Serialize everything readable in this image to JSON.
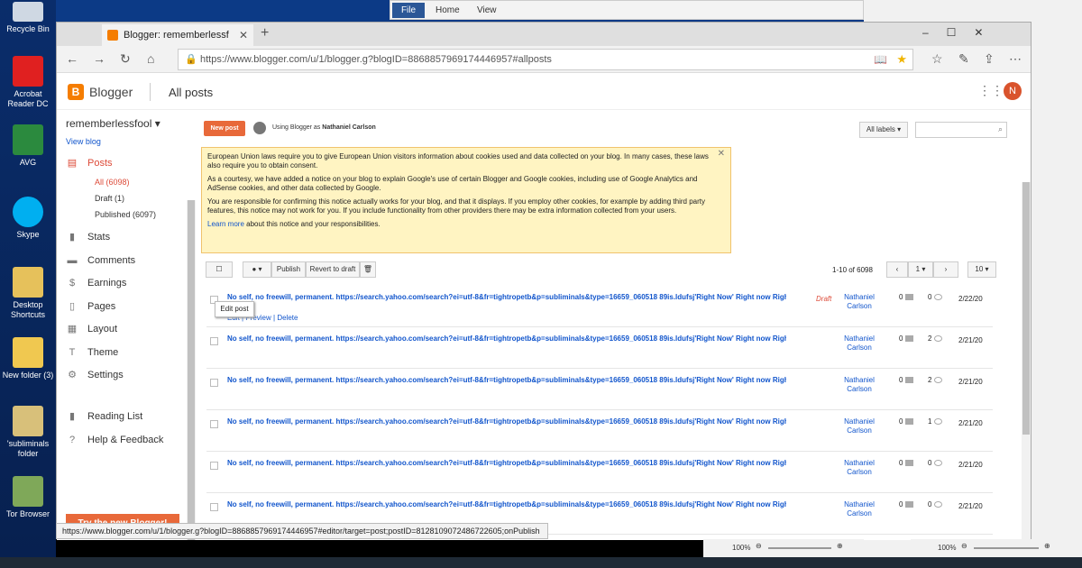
{
  "desktop": {
    "icons": [
      "Recycle Bin",
      "Acrobat Reader DC",
      "AVG",
      "Skype",
      "Desktop Shortcuts",
      "New folder (3)",
      "'subliminals folder",
      "Tor Browser"
    ]
  },
  "word": {
    "file": "File",
    "home": "Home",
    "view": "View"
  },
  "browser": {
    "tab_title": "Blogger: rememberlessf",
    "url": "https://www.blogger.com/u/1/blogger.g?blogID=8868857969174446957#allposts",
    "status_url": "https://www.blogger.com/u/1/blogger.g?blogID=8868857969174446957#editor/target=post;postID=8128109072486722605;onPublish"
  },
  "header": {
    "brand": "Blogger",
    "page_title": "All posts",
    "avatar": "N"
  },
  "sidebar": {
    "blog_name": "rememberlessfool",
    "view_blog": "View blog",
    "posts": "Posts",
    "all": "All (6098)",
    "draft": "Draft (1)",
    "published": "Published (6097)",
    "items": [
      "Stats",
      "Comments",
      "Earnings",
      "Pages",
      "Layout",
      "Theme",
      "Settings",
      "Reading List",
      "Help & Feedback"
    ],
    "try_new": "Try the new Blogger!"
  },
  "toolbar": {
    "new_post": "New post",
    "using_as": "Using Blogger as",
    "user": "Nathaniel Carlson",
    "all_labels": "All labels",
    "publish": "Publish",
    "revert": "Revert to draft",
    "range": "1-10 of 6098",
    "page": "1",
    "per_page": "10"
  },
  "notice": {
    "p1": "European Union laws require you to give European Union visitors information about cookies used and data collected on your blog. In many cases, these laws also require you to obtain consent.",
    "p2": "As a courtesy, we have added a notice on your blog to explain Google's use of certain Blogger and Google cookies, including use of Google Analytics and AdSense cookies, and other data collected by Google.",
    "p3": "You are responsible for confirming this notice actually works for your blog, and that it displays. If you employ other cookies, for example by adding third party features, this notice may not work for you. If you include functionality from other providers there may be extra information collected from your users.",
    "learn_more": "Learn more",
    "p4": "about this notice and your responsibilities."
  },
  "tooltip": "Edit post",
  "row_actions": {
    "edit": "Edit",
    "preview": "Preview",
    "delete": "Delete"
  },
  "posts": [
    {
      "title": "No self, no freewill, permanent. https://search.yahoo.com/search?ei=utf-8&fr=tightropetb&p=subliminals&type=16659_060518 89is.ldufsj'Right Now' Right now Right ...",
      "status": "Draft",
      "author": "Nathaniel Carlson",
      "comments": "0",
      "views": "0",
      "date": "2/22/20"
    },
    {
      "title": "No self, no freewill, permanent. https://search.yahoo.com/search?ei=utf-8&fr=tightropetb&p=subliminals&type=16659_060518 89is.ldufsj'Right Now' Right now Right ...",
      "status": "",
      "author": "Nathaniel Carlson",
      "comments": "0",
      "views": "2",
      "date": "2/21/20"
    },
    {
      "title": "No self, no freewill, permanent. https://search.yahoo.com/search?ei=utf-8&fr=tightropetb&p=subliminals&type=16659_060518 89is.ldufsj'Right Now' Right now Right ...",
      "status": "",
      "author": "Nathaniel Carlson",
      "comments": "0",
      "views": "2",
      "date": "2/21/20"
    },
    {
      "title": "No self, no freewill, permanent. https://search.yahoo.com/search?ei=utf-8&fr=tightropetb&p=subliminals&type=16659_060518 89is.ldufsj'Right Now' Right now Right ...",
      "status": "",
      "author": "Nathaniel Carlson",
      "comments": "0",
      "views": "1",
      "date": "2/21/20"
    },
    {
      "title": "No self, no freewill, permanent. https://search.yahoo.com/search?ei=utf-8&fr=tightropetb&p=subliminals&type=16659_060518 89is.ldufsj'Right Now' Right now Right ...",
      "status": "",
      "author": "Nathaniel Carlson",
      "comments": "0",
      "views": "0",
      "date": "2/21/20"
    },
    {
      "title": "No self, no freewill, permanent. https://search.yahoo.com/search?ei=utf-8&fr=tightropetb&p=subliminals&type=16659_060518 89is.ldufsj'Right Now' Right now Right ...",
      "status": "",
      "author": "Nathaniel Carlson",
      "comments": "0",
      "views": "0",
      "date": "2/21/20"
    }
  ],
  "zoom": {
    "left": "100%",
    "right": "100%"
  },
  "colors": {
    "brand": "#f57d00",
    "link": "#1155cc",
    "draft": "#dd4b39",
    "notice_bg": "#fff4c2"
  }
}
